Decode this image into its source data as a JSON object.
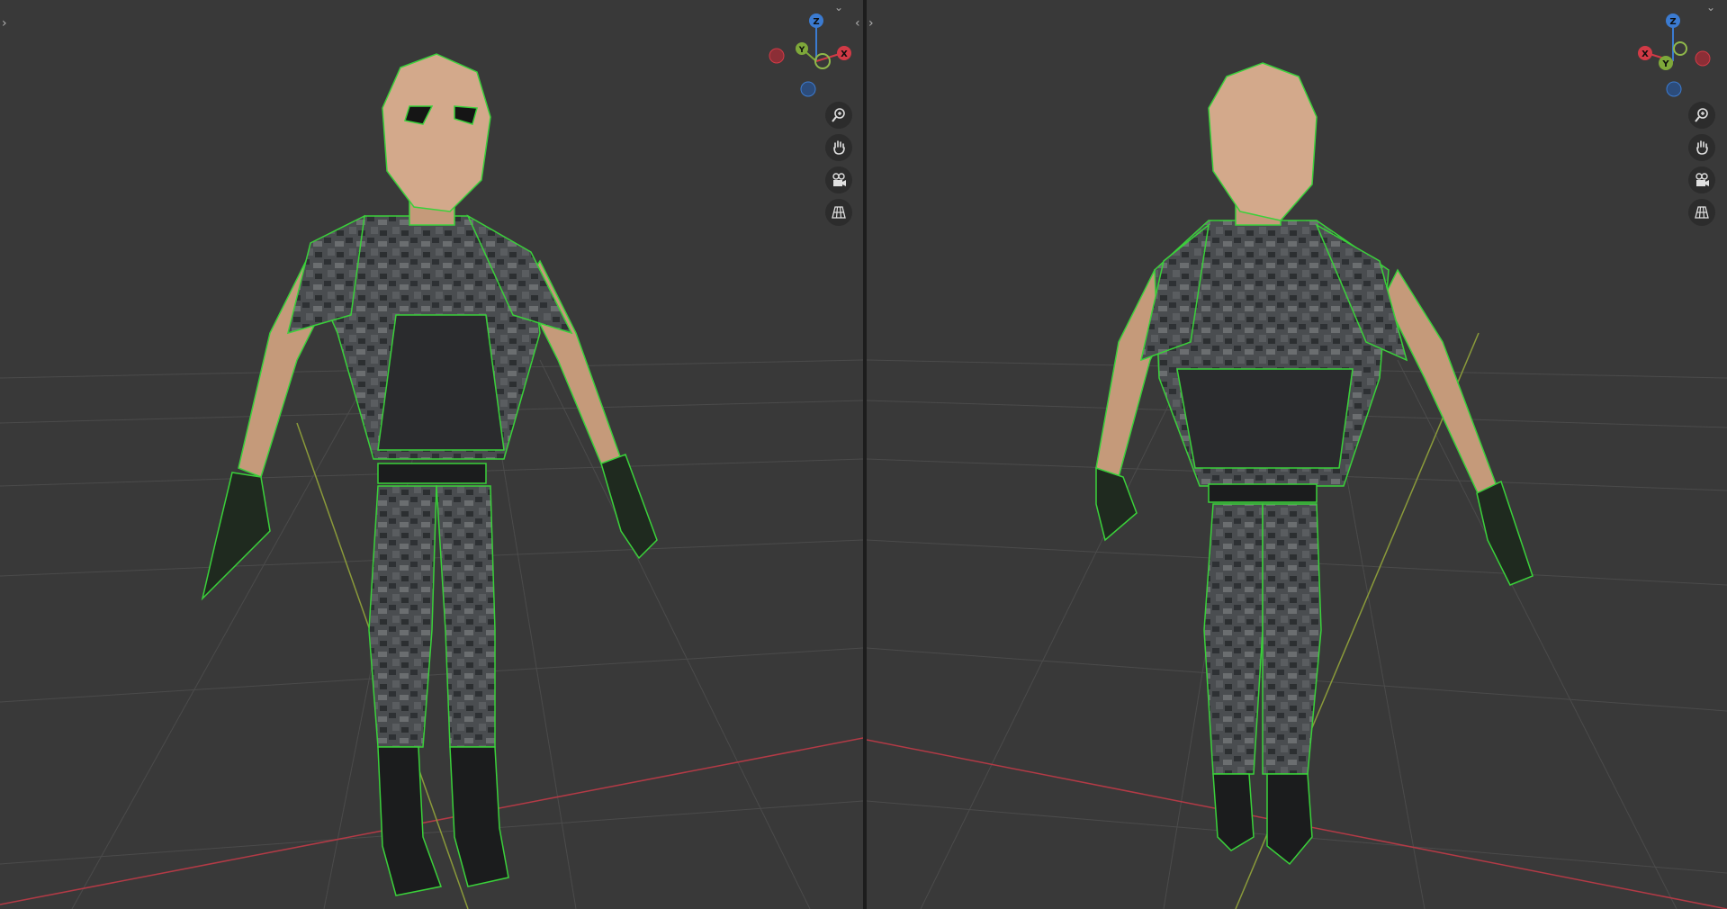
{
  "app": {
    "accent_wire": "#3ad13a",
    "grid_line": "#4a4a4a",
    "x_axis_color": "#b33a46",
    "y_axis_color": "#8a9a3a"
  },
  "viewports": [
    {
      "id": "front",
      "gizmo": {
        "z_label": "Z",
        "y_label": "Y",
        "x_label": "X",
        "z_color": "#3b7bd1",
        "y_color": "#7ea83a",
        "x_color": "#d23a46"
      },
      "tools": [
        "zoom-icon",
        "pan-hand-icon",
        "camera-view-icon",
        "grid-ortho-icon"
      ]
    },
    {
      "id": "back",
      "gizmo": {
        "z_label": "Z",
        "y_label": "Y",
        "x_label": "X",
        "z_color": "#3b7bd1",
        "y_color": "#7ea83a",
        "x_color": "#d23a46"
      },
      "tools": [
        "zoom-icon",
        "pan-hand-icon",
        "camera-view-icon",
        "grid-ortho-icon"
      ]
    }
  ]
}
